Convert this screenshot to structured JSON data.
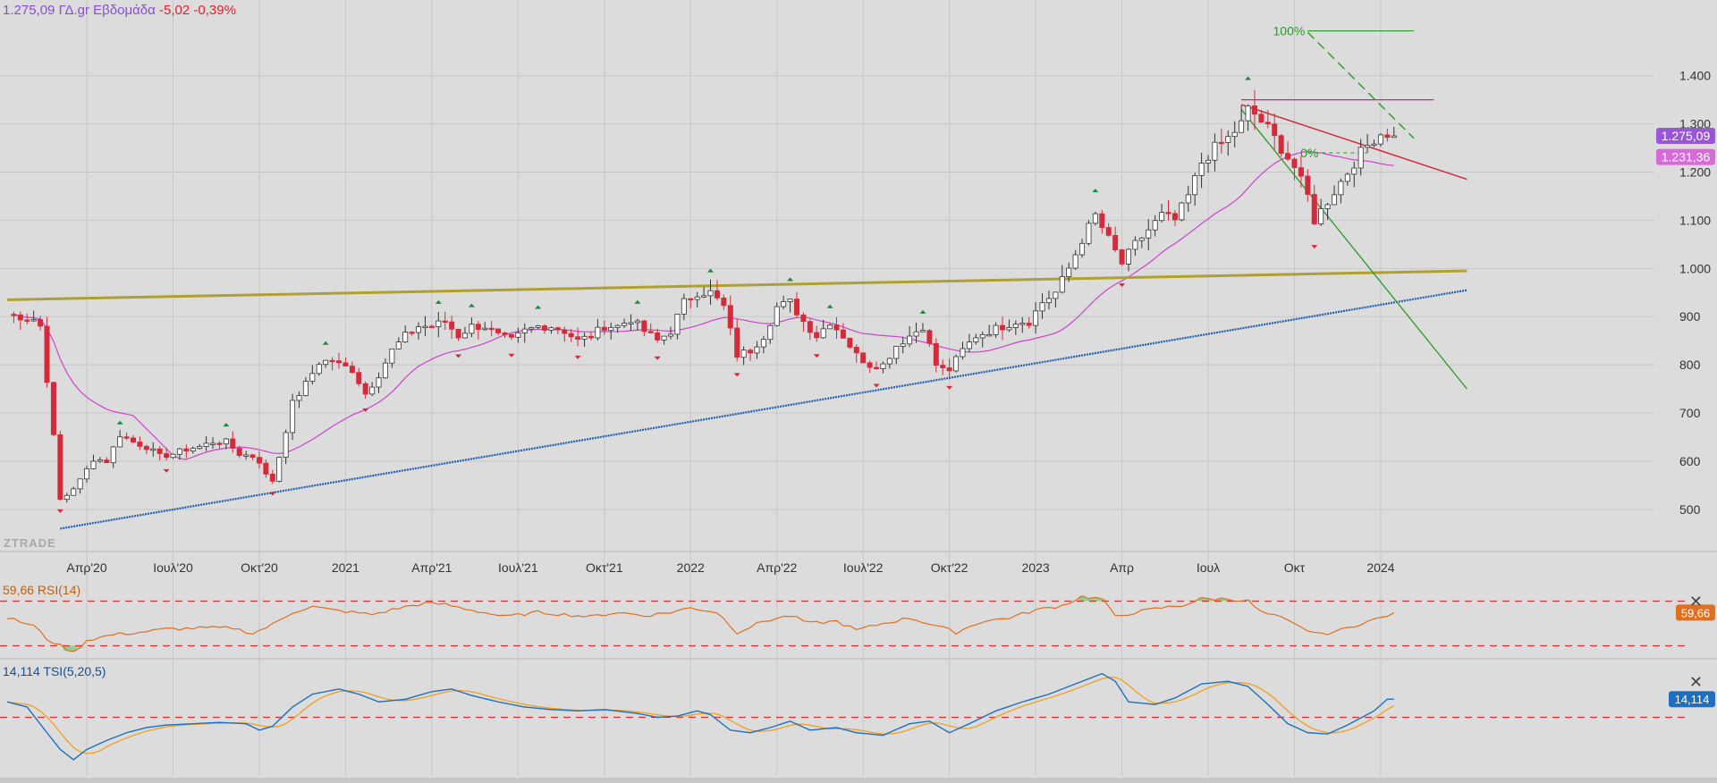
{
  "header": {
    "price": "1.275,09",
    "symbol": "ΓΔ.gr",
    "period": "Εβδομάδα",
    "change": "-5,02",
    "change_pct": "-0,39%"
  },
  "watermark": "ZTRADE",
  "colors": {
    "background": "#dcdcdc",
    "up_candle": "#ffffff",
    "down_candle": "#d42a3a",
    "sma": "#cc44cc",
    "rsi": "#e07020",
    "tsi": "#1f6fbf",
    "tsi_signal": "#f0a020",
    "resistance": "#b0a030",
    "support": "#1f5fb0",
    "fib": "#2a9a2a",
    "badge_price": "#9a55d8",
    "badge_sma": "#d66bd8",
    "badge_tsi": "#1f6fbf",
    "badge_rsi": "#e07020"
  },
  "rsi": {
    "label": "59,66 RSI(14)",
    "value": "59,66",
    "upper": 70,
    "lower": 30
  },
  "tsi": {
    "label": "14,114 TSI(5,20,5)",
    "value": "14,114",
    "zero": 0
  },
  "badges": {
    "price": "1.275,09",
    "sma": "1.231,36"
  },
  "fib_labels": {
    "top": "100%",
    "zero": "0%"
  },
  "close_glyph": "✕",
  "chart_data": {
    "type": "candlestick",
    "title": "ΓΔ.gr Εβδομάδα",
    "timeframe": "weekly",
    "y_ticks": [
      500,
      600,
      700,
      800,
      900,
      1000,
      1100,
      1200,
      1300,
      1400
    ],
    "y_tick_labels": [
      "500",
      "600",
      "700",
      "800",
      "900",
      "1.000",
      "1.100",
      "1.200",
      "1.300",
      "1.400"
    ],
    "ylim": [
      420,
      1520
    ],
    "x_ticks": [
      {
        "label": "Απρ'20",
        "t": 12
      },
      {
        "label": "Ιουλ'20",
        "t": 25
      },
      {
        "label": "Οκτ'20",
        "t": 38
      },
      {
        "label": "2021",
        "t": 51
      },
      {
        "label": "Απρ'21",
        "t": 64
      },
      {
        "label": "Ιουλ'21",
        "t": 77
      },
      {
        "label": "Οκτ'21",
        "t": 90
      },
      {
        "label": "2022",
        "t": 103
      },
      {
        "label": "Απρ'22",
        "t": 116
      },
      {
        "label": "Ιουλ'22",
        "t": 129
      },
      {
        "label": "Οκτ'22",
        "t": 142
      },
      {
        "label": "2023",
        "t": 155
      },
      {
        "label": "Απρ",
        "t": 168
      },
      {
        "label": "Ιουλ",
        "t": 181
      },
      {
        "label": "Οκτ",
        "t": 194
      },
      {
        "label": "2024",
        "t": 207
      }
    ],
    "anchors": [
      [
        0,
        905
      ],
      [
        2,
        900
      ],
      [
        4,
        895
      ],
      [
        5,
        880
      ],
      [
        6,
        770
      ],
      [
        7,
        650
      ],
      [
        8,
        520
      ],
      [
        9,
        530
      ],
      [
        11,
        560
      ],
      [
        13,
        605
      ],
      [
        15,
        600
      ],
      [
        17,
        655
      ],
      [
        19,
        640
      ],
      [
        21,
        630
      ],
      [
        23,
        610
      ],
      [
        25,
        615
      ],
      [
        27,
        625
      ],
      [
        29,
        630
      ],
      [
        31,
        640
      ],
      [
        33,
        640
      ],
      [
        35,
        615
      ],
      [
        37,
        610
      ],
      [
        38,
        600
      ],
      [
        39,
        570
      ],
      [
        40,
        560
      ],
      [
        41,
        610
      ],
      [
        43,
        720
      ],
      [
        45,
        760
      ],
      [
        47,
        805
      ],
      [
        49,
        810
      ],
      [
        50,
        800
      ],
      [
        52,
        790
      ],
      [
        54,
        740
      ],
      [
        56,
        780
      ],
      [
        58,
        830
      ],
      [
        60,
        860
      ],
      [
        62,
        880
      ],
      [
        64,
        880
      ],
      [
        66,
        890
      ],
      [
        68,
        860
      ],
      [
        70,
        880
      ],
      [
        72,
        880
      ],
      [
        74,
        860
      ],
      [
        76,
        850
      ],
      [
        78,
        870
      ],
      [
        80,
        880
      ],
      [
        82,
        880
      ],
      [
        84,
        870
      ],
      [
        86,
        850
      ],
      [
        88,
        860
      ],
      [
        90,
        880
      ],
      [
        92,
        880
      ],
      [
        94,
        895
      ],
      [
        96,
        870
      ],
      [
        98,
        850
      ],
      [
        100,
        870
      ],
      [
        102,
        930
      ],
      [
        104,
        950
      ],
      [
        106,
        950
      ],
      [
        108,
        920
      ],
      [
        110,
        820
      ],
      [
        112,
        830
      ],
      [
        114,
        860
      ],
      [
        116,
        920
      ],
      [
        118,
        930
      ],
      [
        120,
        890
      ],
      [
        122,
        860
      ],
      [
        124,
        890
      ],
      [
        126,
        860
      ],
      [
        128,
        820
      ],
      [
        130,
        800
      ],
      [
        132,
        800
      ],
      [
        134,
        840
      ],
      [
        136,
        860
      ],
      [
        138,
        880
      ],
      [
        140,
        800
      ],
      [
        141,
        790
      ],
      [
        142,
        790
      ],
      [
        144,
        830
      ],
      [
        146,
        860
      ],
      [
        148,
        870
      ],
      [
        150,
        880
      ],
      [
        152,
        890
      ],
      [
        154,
        890
      ],
      [
        156,
        930
      ],
      [
        158,
        950
      ],
      [
        160,
        1000
      ],
      [
        162,
        1060
      ],
      [
        164,
        1110
      ],
      [
        166,
        1060
      ],
      [
        168,
        1010
      ],
      [
        170,
        1050
      ],
      [
        172,
        1080
      ],
      [
        174,
        1110
      ],
      [
        176,
        1100
      ],
      [
        178,
        1150
      ],
      [
        180,
        1220
      ],
      [
        182,
        1250
      ],
      [
        184,
        1270
      ],
      [
        186,
        1300
      ],
      [
        187,
        1330
      ],
      [
        188,
        1320
      ],
      [
        190,
        1290
      ],
      [
        192,
        1250
      ],
      [
        194,
        1210
      ],
      [
        196,
        1150
      ],
      [
        197,
        1100
      ],
      [
        198,
        1120
      ],
      [
        200,
        1160
      ],
      [
        202,
        1200
      ],
      [
        204,
        1240
      ],
      [
        206,
        1270
      ],
      [
        207,
        1280
      ]
    ],
    "series": [
      {
        "name": "Close",
        "kind": "candles"
      },
      {
        "name": "SMA",
        "kind": "line"
      }
    ],
    "trendlines": [
      {
        "name": "resistance",
        "from": [
          0,
          935
        ],
        "to": [
          220,
          995
        ]
      },
      {
        "name": "support",
        "from": [
          8,
          460
        ],
        "to": [
          220,
          955
        ]
      },
      {
        "name": "channel-upper",
        "from": [
          186,
          1340
        ],
        "to": [
          220,
          1185
        ]
      },
      {
        "name": "fib-descending",
        "from": [
          186,
          1330
        ],
        "to": [
          220,
          750
        ]
      },
      {
        "name": "fib-extension",
        "from": [
          196,
          1490
        ],
        "to": [
          212,
          1270
        ]
      },
      {
        "name": "horizontal-high",
        "from": [
          186,
          1350
        ],
        "to": [
          215,
          1350
        ]
      },
      {
        "name": "fib-100",
        "from": [
          196,
          1493
        ],
        "to": [
          212,
          1493
        ]
      },
      {
        "name": "fib-0",
        "from": [
          196,
          1240
        ],
        "to": [
          205,
          1240
        ]
      }
    ],
    "rsi_ylim": [
      20,
      80
    ],
    "tsi_ylim": [
      -40,
      40
    ],
    "rsi_anchors": [
      [
        0,
        55
      ],
      [
        4,
        48
      ],
      [
        6,
        36
      ],
      [
        8,
        30
      ],
      [
        10,
        24
      ],
      [
        12,
        35
      ],
      [
        16,
        40
      ],
      [
        20,
        42
      ],
      [
        24,
        45
      ],
      [
        30,
        46
      ],
      [
        34,
        46
      ],
      [
        37,
        41
      ],
      [
        40,
        49
      ],
      [
        43,
        60
      ],
      [
        46,
        65
      ],
      [
        49,
        62
      ],
      [
        52,
        60
      ],
      [
        55,
        58
      ],
      [
        60,
        65
      ],
      [
        63,
        68
      ],
      [
        66,
        67
      ],
      [
        70,
        62
      ],
      [
        75,
        56
      ],
      [
        80,
        60
      ],
      [
        84,
        58
      ],
      [
        88,
        56
      ],
      [
        92,
        60
      ],
      [
        96,
        57
      ],
      [
        100,
        60
      ],
      [
        103,
        64
      ],
      [
        107,
        60
      ],
      [
        110,
        42
      ],
      [
        114,
        52
      ],
      [
        118,
        57
      ],
      [
        121,
        50
      ],
      [
        125,
        52
      ],
      [
        128,
        44
      ],
      [
        132,
        50
      ],
      [
        136,
        55
      ],
      [
        140,
        48
      ],
      [
        143,
        42
      ],
      [
        147,
        52
      ],
      [
        151,
        55
      ],
      [
        155,
        62
      ],
      [
        159,
        66
      ],
      [
        162,
        74
      ],
      [
        165,
        72
      ],
      [
        167,
        56
      ],
      [
        170,
        60
      ],
      [
        174,
        64
      ],
      [
        177,
        66
      ],
      [
        180,
        72
      ],
      [
        184,
        72
      ],
      [
        187,
        70
      ],
      [
        189,
        60
      ],
      [
        192,
        55
      ],
      [
        195,
        46
      ],
      [
        198,
        40
      ],
      [
        201,
        44
      ],
      [
        204,
        50
      ],
      [
        207,
        55
      ],
      [
        209,
        59.66
      ]
    ],
    "tsi_anchors": [
      [
        0,
        12
      ],
      [
        3,
        8
      ],
      [
        6,
        -12
      ],
      [
        8,
        -25
      ],
      [
        10,
        -33
      ],
      [
        12,
        -25
      ],
      [
        15,
        -18
      ],
      [
        18,
        -12
      ],
      [
        21,
        -8
      ],
      [
        24,
        -6
      ],
      [
        28,
        -5
      ],
      [
        32,
        -4
      ],
      [
        36,
        -5
      ],
      [
        38,
        -10
      ],
      [
        40,
        -7
      ],
      [
        43,
        8
      ],
      [
        46,
        18
      ],
      [
        50,
        22
      ],
      [
        53,
        18
      ],
      [
        56,
        12
      ],
      [
        60,
        14
      ],
      [
        64,
        20
      ],
      [
        67,
        22
      ],
      [
        70,
        17
      ],
      [
        74,
        12
      ],
      [
        78,
        8
      ],
      [
        82,
        6
      ],
      [
        86,
        5
      ],
      [
        90,
        6
      ],
      [
        95,
        3
      ],
      [
        98,
        0
      ],
      [
        101,
        1
      ],
      [
        104,
        5
      ],
      [
        106,
        2
      ],
      [
        109,
        -10
      ],
      [
        112,
        -12
      ],
      [
        115,
        -8
      ],
      [
        118,
        -3
      ],
      [
        121,
        -10
      ],
      [
        125,
        -8
      ],
      [
        128,
        -12
      ],
      [
        132,
        -14
      ],
      [
        136,
        -5
      ],
      [
        139,
        -3
      ],
      [
        142,
        -12
      ],
      [
        145,
        -5
      ],
      [
        149,
        5
      ],
      [
        153,
        12
      ],
      [
        157,
        18
      ],
      [
        161,
        26
      ],
      [
        165,
        34
      ],
      [
        167,
        28
      ],
      [
        169,
        12
      ],
      [
        173,
        10
      ],
      [
        176,
        15
      ],
      [
        180,
        26
      ],
      [
        184,
        28
      ],
      [
        187,
        24
      ],
      [
        190,
        10
      ],
      [
        193,
        -5
      ],
      [
        196,
        -12
      ],
      [
        199,
        -13
      ],
      [
        202,
        -6
      ],
      [
        206,
        5
      ],
      [
        208,
        14.114
      ]
    ],
    "tsi_signal_lag": 2
  }
}
